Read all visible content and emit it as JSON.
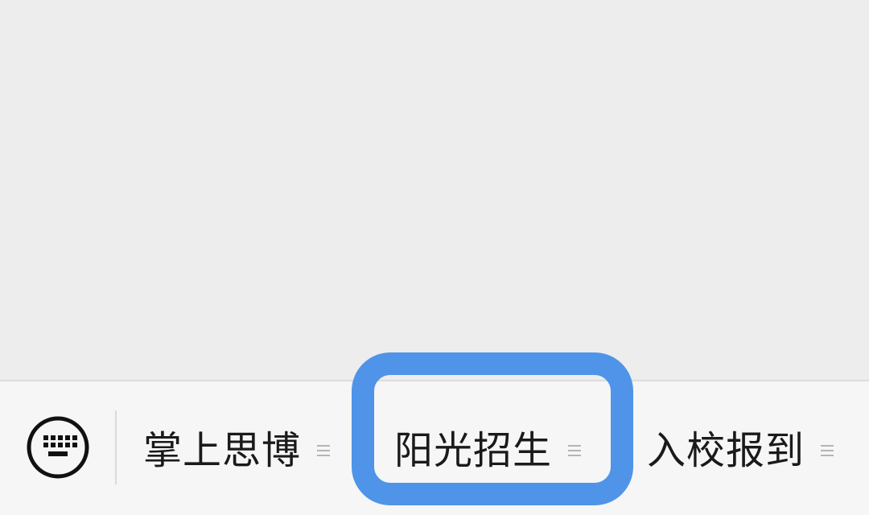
{
  "menu": {
    "keyboard_icon": "keyboard-icon",
    "items": [
      {
        "label": "掌上思博",
        "icon": "submenu-icon"
      },
      {
        "label": "阳光招生",
        "icon": "submenu-icon"
      },
      {
        "label": "入校报到",
        "icon": "submenu-icon"
      }
    ]
  },
  "colors": {
    "content_background": "#ededed",
    "menu_background": "#f6f6f6",
    "highlight": "#4f94e8"
  }
}
